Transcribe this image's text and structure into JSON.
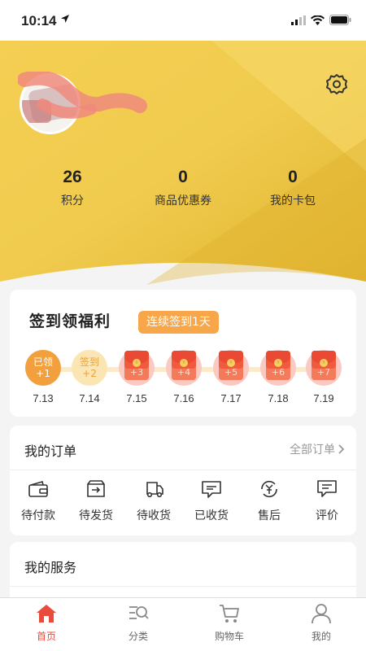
{
  "status_bar": {
    "time": "10:14"
  },
  "stats": [
    {
      "value": "26",
      "label": "积分"
    },
    {
      "value": "0",
      "label": "商品优惠券"
    },
    {
      "value": "0",
      "label": "我的卡包"
    }
  ],
  "checkin": {
    "title": "签到领福利",
    "streak": "连续签到1天",
    "days": [
      {
        "status": "已领",
        "bonus": "+1",
        "date": "7.13"
      },
      {
        "status": "签到",
        "bonus": "+2",
        "date": "7.14"
      },
      {
        "bonus": "+3",
        "date": "7.15"
      },
      {
        "bonus": "+4",
        "date": "7.16"
      },
      {
        "bonus": "+5",
        "date": "7.17"
      },
      {
        "bonus": "+6",
        "date": "7.18"
      },
      {
        "bonus": "+7",
        "date": "7.19"
      }
    ]
  },
  "orders": {
    "title": "我的订单",
    "all_label": "全部订单",
    "items": [
      {
        "label": "待付款",
        "icon": "wallet-icon"
      },
      {
        "label": "待发货",
        "icon": "package-icon"
      },
      {
        "label": "待收货",
        "icon": "truck-icon"
      },
      {
        "label": "已收货",
        "icon": "message-check-icon"
      },
      {
        "label": "售后",
        "icon": "refund-icon"
      },
      {
        "label": "评价",
        "icon": "comment-icon"
      }
    ]
  },
  "services": {
    "title": "我的服务"
  },
  "tabbar": [
    {
      "label": "首页",
      "icon": "home-icon",
      "active": true
    },
    {
      "label": "分类",
      "icon": "category-icon"
    },
    {
      "label": "购物车",
      "icon": "cart-icon"
    },
    {
      "label": "我的",
      "icon": "user-icon"
    }
  ],
  "colors": {
    "accent": "#e84c3d",
    "gold": "#f2c744",
    "badge": "#f7a64a"
  }
}
